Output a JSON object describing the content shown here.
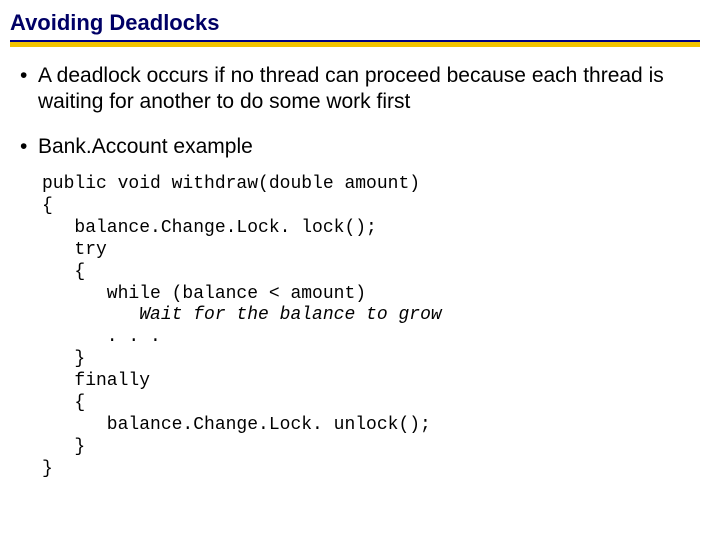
{
  "title": "Avoiding Deadlocks",
  "bullets": [
    "A deadlock occurs if no thread can proceed because each thread is waiting for another to do some work first",
    "Bank.Account example"
  ],
  "code": {
    "l1": "public void withdraw(double amount)",
    "l2": "{",
    "l3": "   balance.Change.Lock. lock();",
    "l4": "   try",
    "l5": "   {",
    "l6": "      while (balance < amount)",
    "l7a": "         ",
    "l7b": "Wait for the balance to grow",
    "l8": "      . . .",
    "l9": "   }",
    "l10": "   finally",
    "l11": "   {",
    "l12": "      balance.Change.Lock. unlock();",
    "l13": "   }",
    "l14": "}"
  }
}
